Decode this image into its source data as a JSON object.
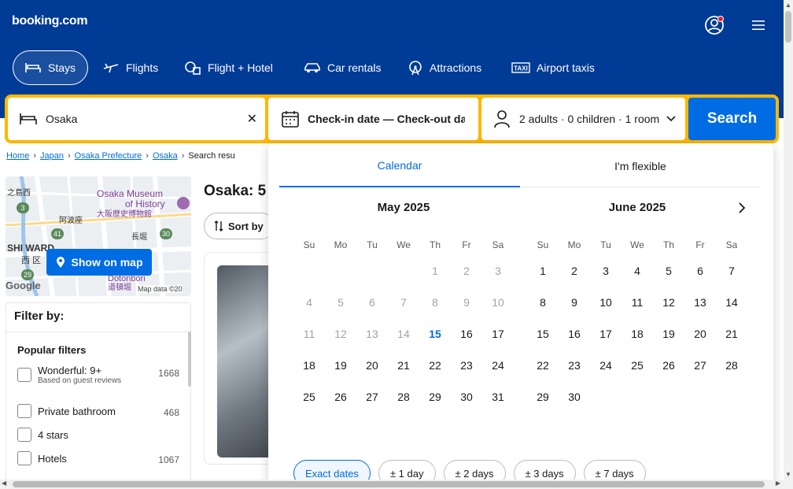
{
  "header": {
    "logo": "booking.com",
    "nav": [
      {
        "label": "Stays"
      },
      {
        "label": "Flights"
      },
      {
        "label": "Flight + Hotel"
      },
      {
        "label": "Car rentals"
      },
      {
        "label": "Attractions"
      },
      {
        "label": "Airport taxis"
      }
    ]
  },
  "search": {
    "destination_value": "Osaka",
    "dates_placeholder": "Check-in date — Check-out date",
    "occupancy": "2 adults · 0 children · 1 room",
    "button": "Search"
  },
  "breadcrumb": {
    "items": [
      "Home",
      "Japan",
      "Osaka Prefecture",
      "Osaka"
    ],
    "current": "Search resu"
  },
  "map": {
    "label_museum_en": "Osaka Museum",
    "label_museum_en2": "of History",
    "label_museum_jp": "大阪歴史博物館",
    "label_shiward": "SHI WARD",
    "label_nishiku": "西 区",
    "label_dotonbori": "Dotonbori",
    "label_dotonbori_jp": "道頓堀",
    "label_abiko": "阿波座",
    "label_nagahori": "長堀",
    "label_kita": "之島西",
    "road_3": "3",
    "road_41": "41",
    "road_30": "30",
    "road_29": "29",
    "attribution": "Map data ©20",
    "google": "Google",
    "show_on_map": "Show on map"
  },
  "filters": {
    "title": "Filter by:",
    "popular_title": "Popular filters",
    "items": [
      {
        "label": "Wonderful: 9+",
        "sub": "Based on guest reviews",
        "count": "1668"
      },
      {
        "label": "Private bathroom",
        "count": "468"
      },
      {
        "label": "4 stars",
        "count": ""
      },
      {
        "label": "Hotels",
        "count": "1067"
      }
    ]
  },
  "results": {
    "title": "Osaka: 5",
    "sort_label": "Sort by"
  },
  "datepicker": {
    "tabs": [
      "Calendar",
      "I'm flexible"
    ],
    "weekdays": [
      "Su",
      "Mo",
      "Tu",
      "We",
      "Th",
      "Fr",
      "Sa"
    ],
    "months": [
      {
        "title": "May 2025",
        "lead_blanks": 4,
        "days": 31,
        "past_until": 14,
        "today": 15
      },
      {
        "title": "June 2025",
        "lead_blanks": 0,
        "days": 30,
        "past_until": 0,
        "today": 0
      }
    ],
    "flex_options": [
      "Exact dates",
      "± 1 day",
      "± 2 days",
      "± 3 days",
      "± 7 days"
    ]
  },
  "colors": {
    "brand_blue": "#003b95",
    "accent_blue": "#006ce4",
    "search_yellow": "#ffb700"
  }
}
